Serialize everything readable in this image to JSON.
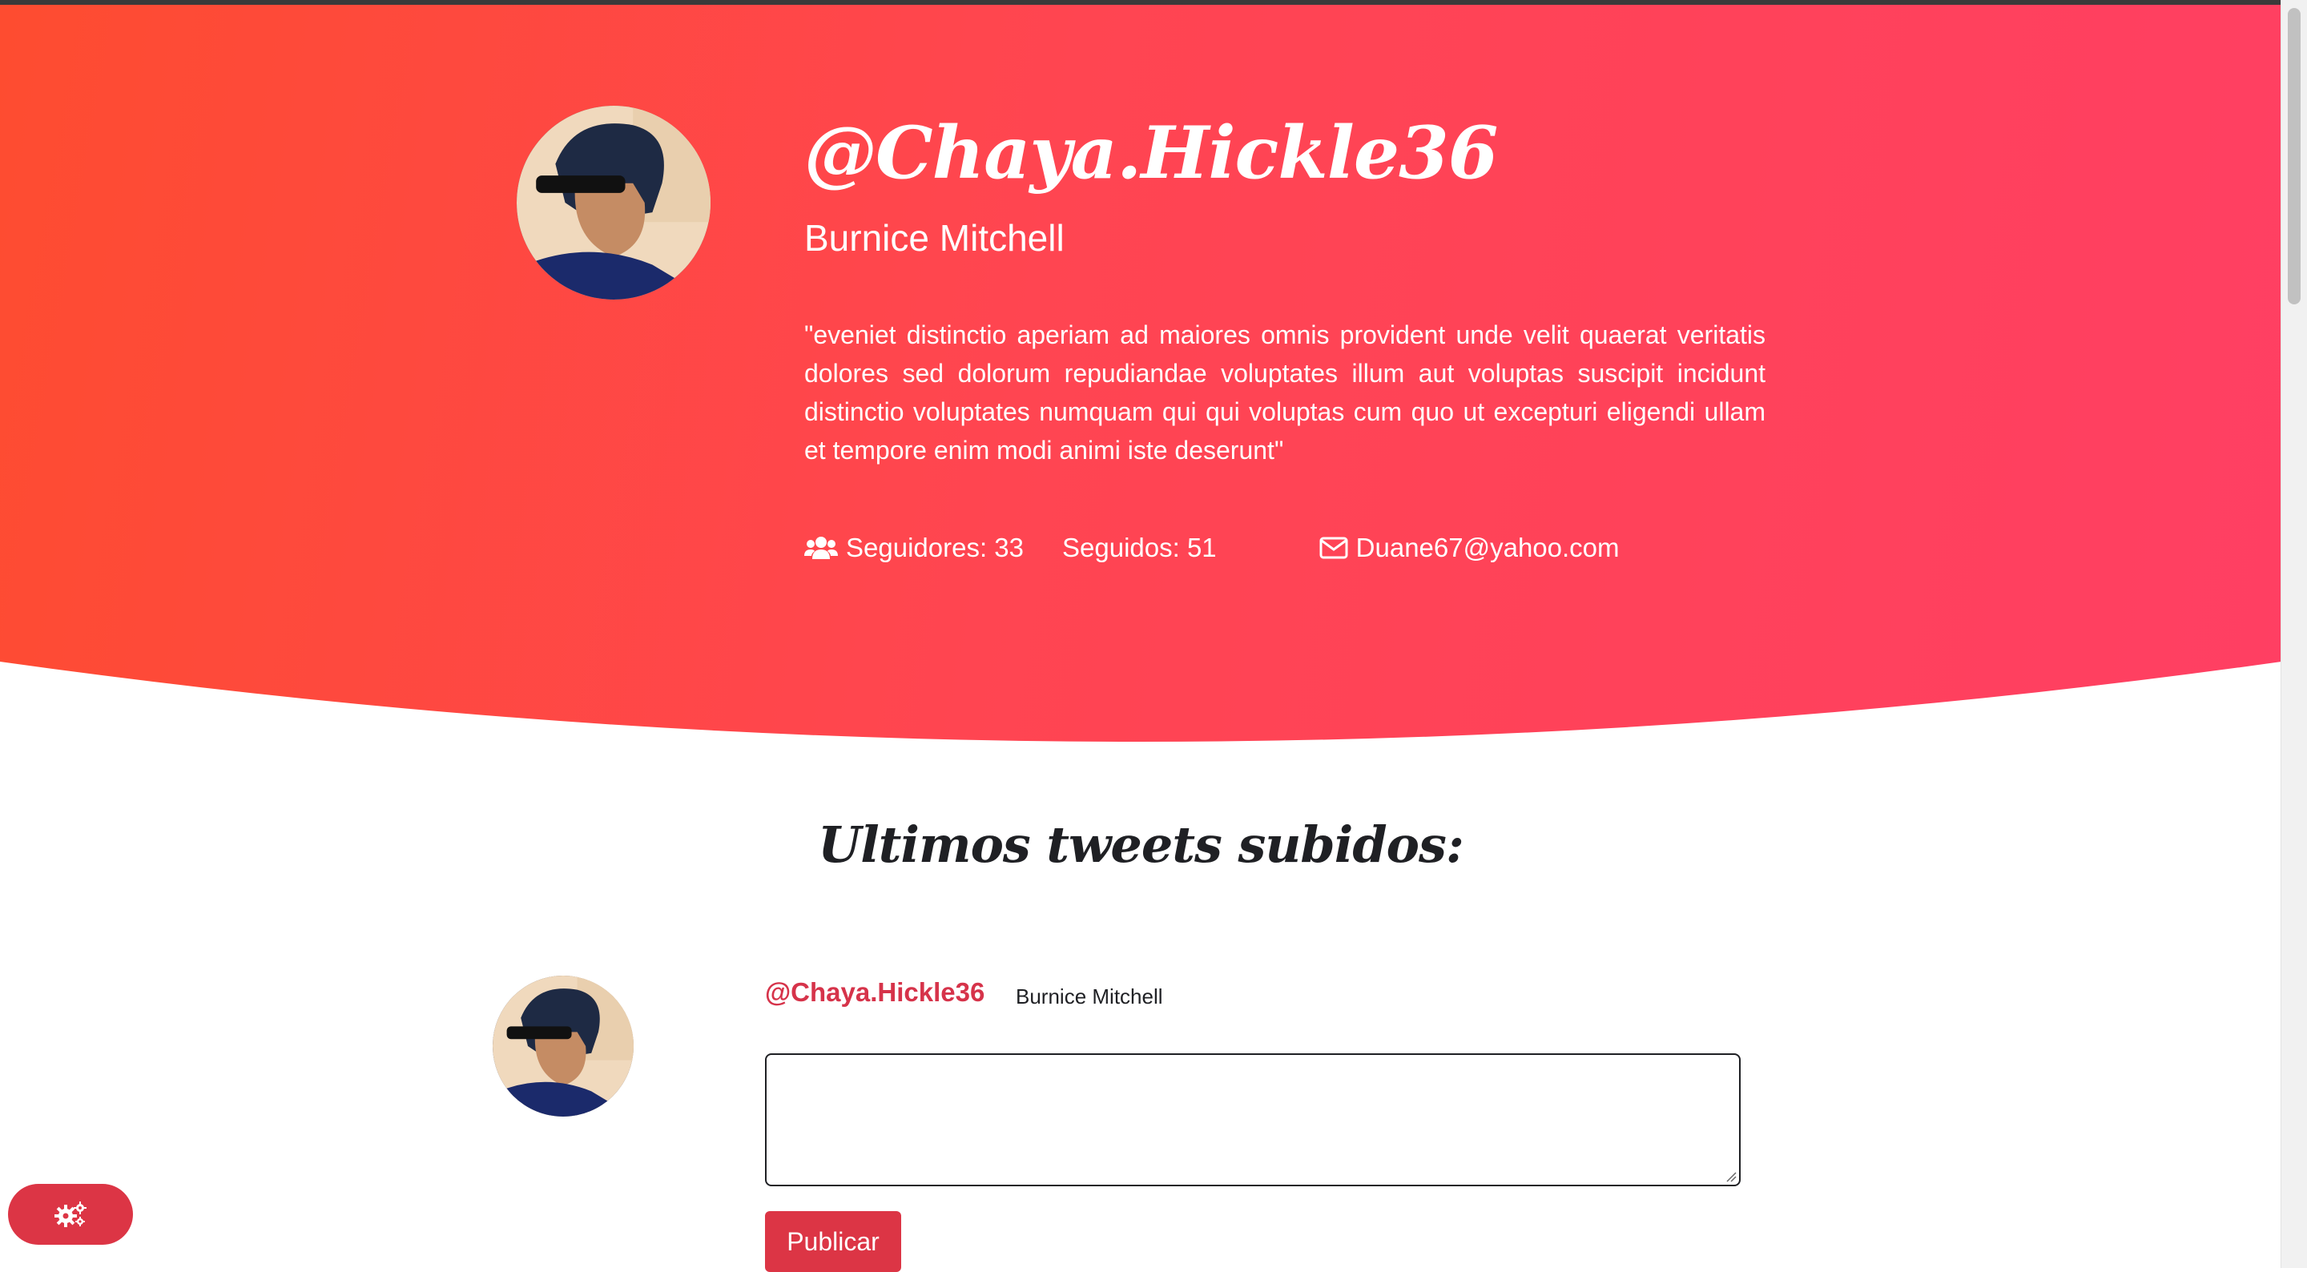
{
  "profile": {
    "username": "@Chaya.Hickle36",
    "full_name": "Burnice Mitchell",
    "bio": "\"eveniet distinctio aperiam ad maiores omnis provident unde velit quaerat veritatis dolores sed dolorum repudiandae voluptates illum aut voluptas suscipit incidunt distinctio voluptates numquam qui qui voluptas cum quo ut excepturi eligendi ullam et tempore enim modi animi iste deserunt\"",
    "followers_label": "Seguidores: 33",
    "following_label": "Seguidos: 51",
    "email": "Duane67@yahoo.com",
    "followers_icon": "users-icon",
    "email_icon": "envelope-icon"
  },
  "feed": {
    "title": "Ultimos tweets subidos:"
  },
  "compose": {
    "username": "@Chaya.Hickle36",
    "full_name": "Burnice Mitchell",
    "input_value": "",
    "publish_label": "Publicar"
  },
  "floating": {
    "settings_icon": "gears-icon"
  },
  "colors": {
    "hero_gradient_start": "#fe4c30",
    "hero_gradient_end": "#ff3f63",
    "accent": "#dc3545",
    "username_accent": "#d6334a"
  }
}
